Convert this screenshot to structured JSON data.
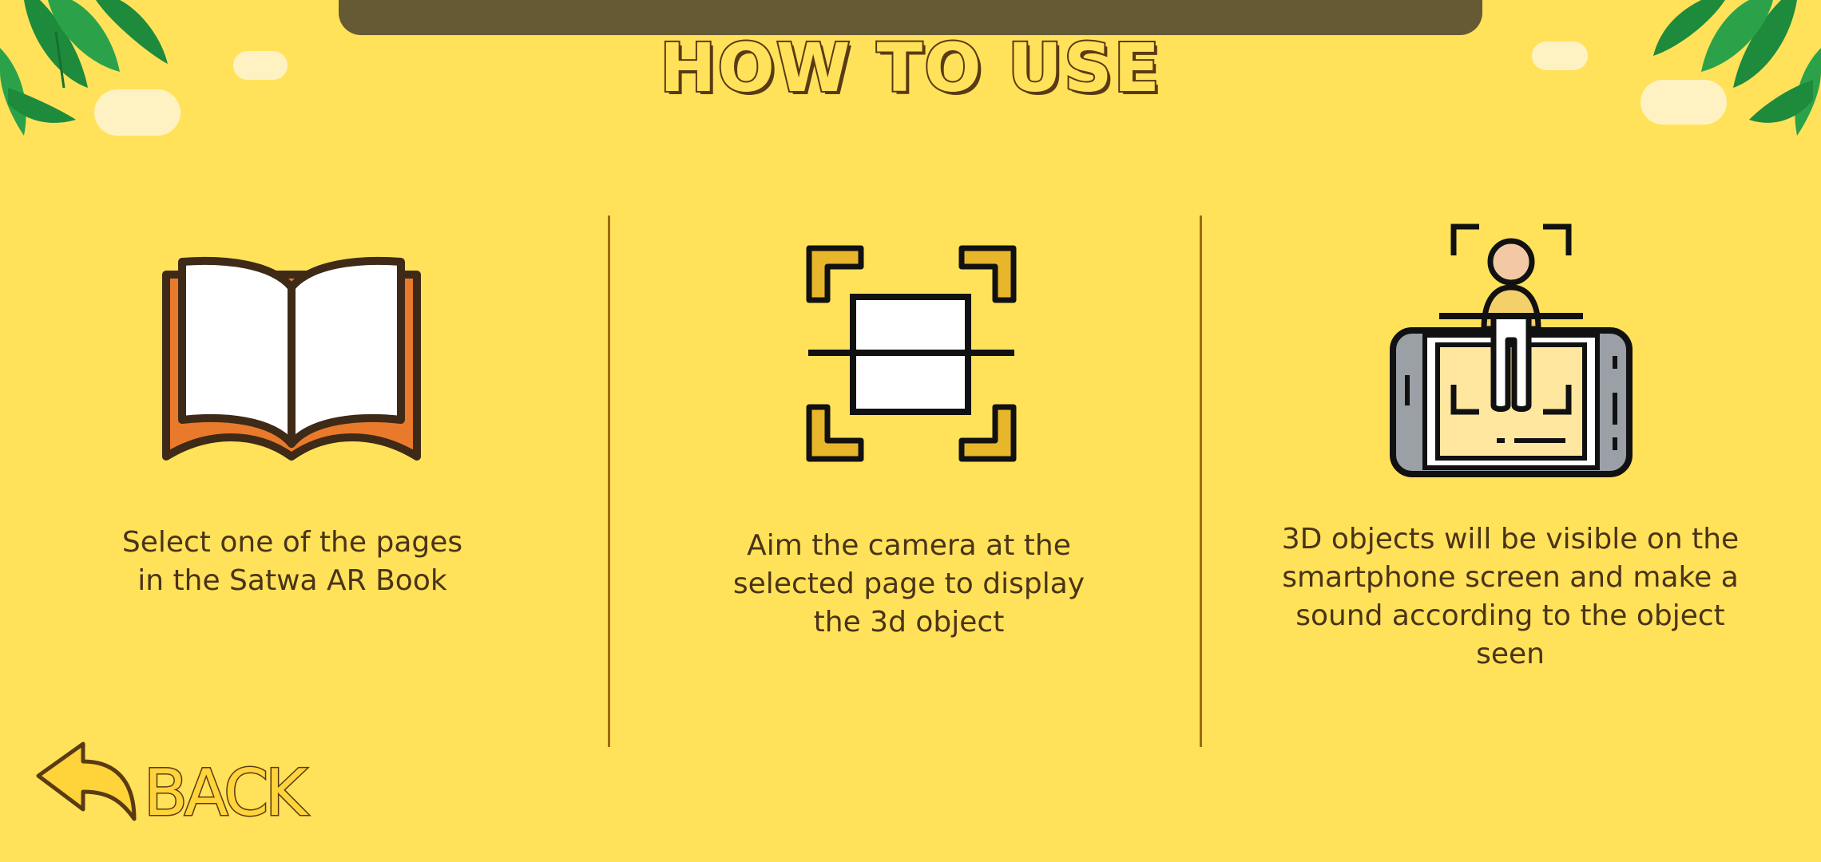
{
  "header": {
    "title": "HOW TO USE"
  },
  "steps": [
    {
      "icon": "open-book-icon",
      "caption_lines": [
        "Select one of the pages",
        "in the Satwa AR Book"
      ]
    },
    {
      "icon": "scan-frame-icon",
      "caption_lines": [
        "Aim the camera at the",
        "selected page to display",
        "the 3d object"
      ]
    },
    {
      "icon": "ar-smartphone-icon",
      "caption_lines": [
        "3D objects will be visible on the",
        "smartphone screen and make a",
        "sound according to the object",
        "seen"
      ]
    }
  ],
  "back_button": {
    "label": "BACK",
    "icon": "back-arrow-icon"
  },
  "colors": {
    "background": "#FFE25A",
    "text": "#4A3318",
    "outline": "#5A3A14",
    "accent": "#FFD43A"
  }
}
